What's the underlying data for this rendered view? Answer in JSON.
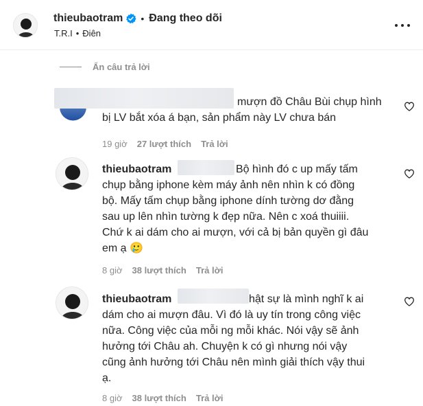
{
  "post_header": {
    "username": "thieubaotram",
    "follow_status": "Đang theo dõi",
    "sub_parts": [
      "T.R.I",
      "Điên"
    ],
    "sub_sep": "•",
    "dot_sep": "•"
  },
  "hide_replies_label": "Ẩn câu trả lời",
  "comments": [
    {
      "lines": [
        "mượn đồ Châu Bùi chụp hình",
        "bị LV bắt xóa á bạn, sản phẩm này LV chưa bán"
      ],
      "time": "19 giờ",
      "likes": "27 lượt thích",
      "reply": "Trả lời"
    },
    {
      "username": "thieubaotram",
      "lines": [
        "Bộ hình đó c up mấy tấm",
        "chụp bằng iphone kèm máy ảnh nên nhìn k có đồng",
        "bộ. Mấy tấm chụp bằng iphone dính tường dơ đằng",
        "sau up lên nhìn tường k đẹp nữa. Nên c xoá thuiiii.",
        "Chứ k ai dám cho ai mượn, với cả bị bản quyền gì đâu",
        "em ạ 🥲"
      ],
      "time": "8 giờ",
      "likes": "38 lượt thích",
      "reply": "Trả lời"
    },
    {
      "username": "thieubaotram",
      "lines": [
        "hật sự là mình nghĩ k ai",
        "dám cho ai mượn đâu. Vì đó là uy tín trong công việc",
        "nữa. Công việc của mỗi ng mỗi khác. Nói vậy sẽ ảnh",
        "hưởng tới Châu ah. Chuyện k có gì nhưng nói vậy",
        "cũng ảnh hưởng tới Châu nên mình giải thích vậy thui",
        "ạ."
      ],
      "time": "8 giờ",
      "likes": "38 lượt thích",
      "reply": "Trả lời"
    }
  ],
  "colors": {
    "text": "#262626",
    "secondary": "#8e8e8e",
    "verified": "#0095f6",
    "divider": "#efefef"
  },
  "icons": {
    "verified": "verified-badge-icon",
    "more": "more-options-icon",
    "like": "heart-icon"
  }
}
